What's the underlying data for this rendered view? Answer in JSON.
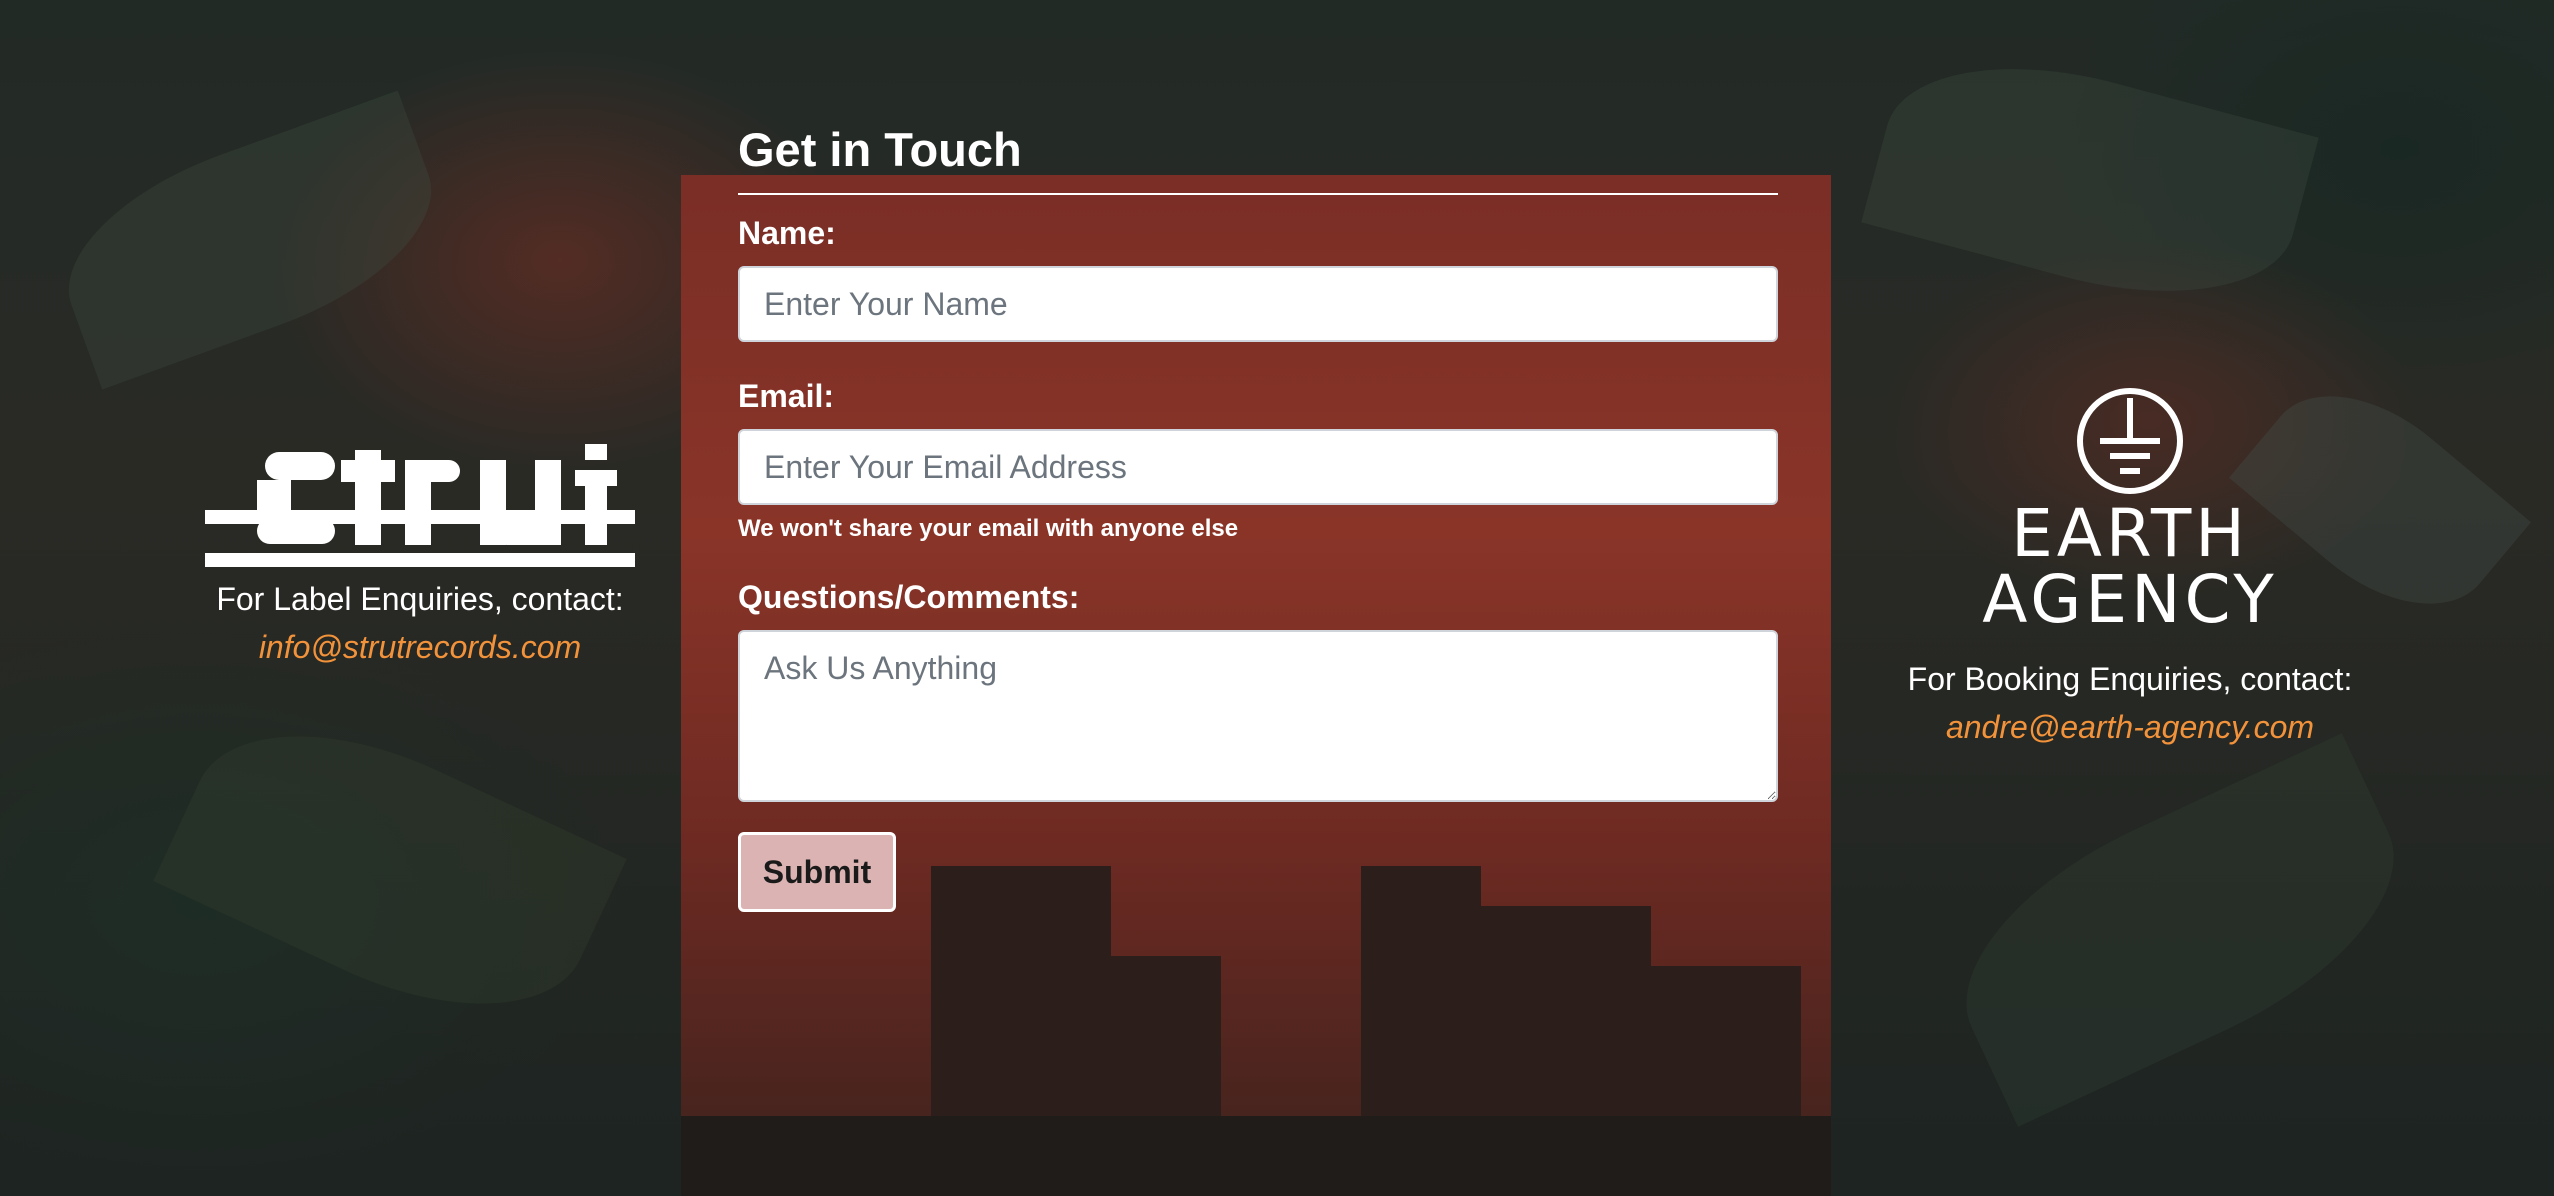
{
  "form": {
    "title": "Get in Touch",
    "name_label": "Name:",
    "name_placeholder": "Enter Your Name",
    "email_label": "Email:",
    "email_placeholder": "Enter Your Email Address",
    "email_help": "We won't share your email with anyone else",
    "comments_label": "Questions/Comments:",
    "comments_placeholder": "Ask Us Anything",
    "submit_label": "Submit"
  },
  "left": {
    "logo_text": "strut",
    "contact_text": "For Label Enquiries, contact:",
    "email": "info@strutrecords.com"
  },
  "right": {
    "logo_text": "EARTH AGENCY",
    "contact_text": "For Booking Enquiries, contact:",
    "email": "andre@earth-agency.com"
  },
  "colors": {
    "accent_link": "#f2923a",
    "submit_bg": "#dbb3b3",
    "panel": "#7a2e26"
  }
}
